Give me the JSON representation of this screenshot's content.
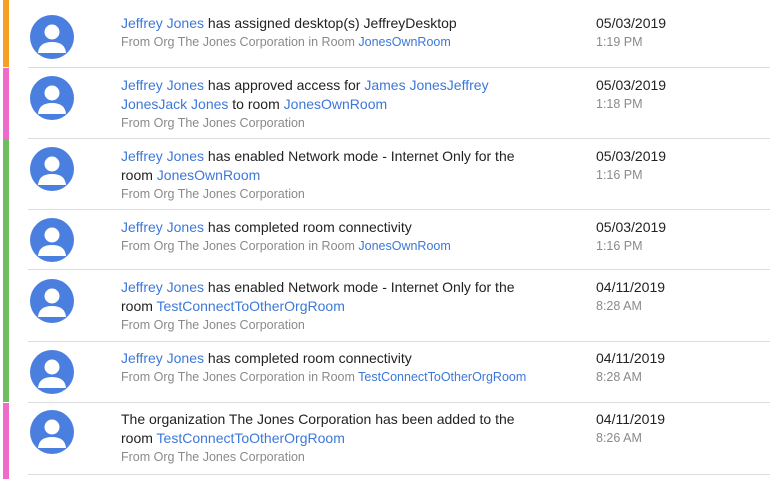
{
  "colors": {
    "orange": "#f5a024",
    "pink": "#f06acb",
    "green": "#6dbf5e",
    "avatar": "#4a7fe0",
    "link": "#3d78d8"
  },
  "avatar_icon": "user-avatar-icon",
  "activities": [
    {
      "actor": "Jeffrey Jones",
      "text1": " has assigned desktop(s) JeffreyDesktop",
      "sub_prefix": "From Org The Jones Corporation in Room ",
      "room": "JonesOwnRoom",
      "date": "05/03/2019",
      "time": "1:19 PM"
    },
    {
      "actor": "Jeffrey Jones",
      "text1": " has approved access for ",
      "users_line1": "James JonesJeffrey",
      "users_line2": "JonesJack Jones",
      "text2": " to room ",
      "room": "JonesOwnRoom",
      "sub": "From Org The Jones Corporation",
      "date": "05/03/2019",
      "time": "1:18 PM"
    },
    {
      "actor": "Jeffrey Jones",
      "text1": " has enabled Network mode - Internet Only for the",
      "text2": "room ",
      "room": "JonesOwnRoom",
      "sub": "From Org The Jones Corporation",
      "date": "05/03/2019",
      "time": "1:16 PM"
    },
    {
      "actor": "Jeffrey Jones",
      "text1": " has completed room connectivity",
      "sub_prefix": "From Org The Jones Corporation in Room ",
      "room": "JonesOwnRoom",
      "date": "05/03/2019",
      "time": "1:16 PM"
    },
    {
      "actor": "Jeffrey Jones",
      "text1": " has enabled Network mode - Internet Only for the",
      "text2": "room ",
      "room": "TestConnectToOtherOrgRoom",
      "sub": "From Org The Jones Corporation",
      "date": "04/11/2019",
      "time": "8:28 AM"
    },
    {
      "actor": "Jeffrey Jones",
      "text1": " has completed room connectivity",
      "sub_prefix": "From Org The Jones Corporation in Room ",
      "room": "TestConnectToOtherOrgRoom",
      "date": "04/11/2019",
      "time": "8:28 AM"
    },
    {
      "text1": "The organization The Jones Corporation has been added to the",
      "text2": "room ",
      "room": "TestConnectToOtherOrgRoom",
      "sub": "From Org The Jones Corporation",
      "date": "04/11/2019",
      "time": "8:26 AM"
    }
  ]
}
